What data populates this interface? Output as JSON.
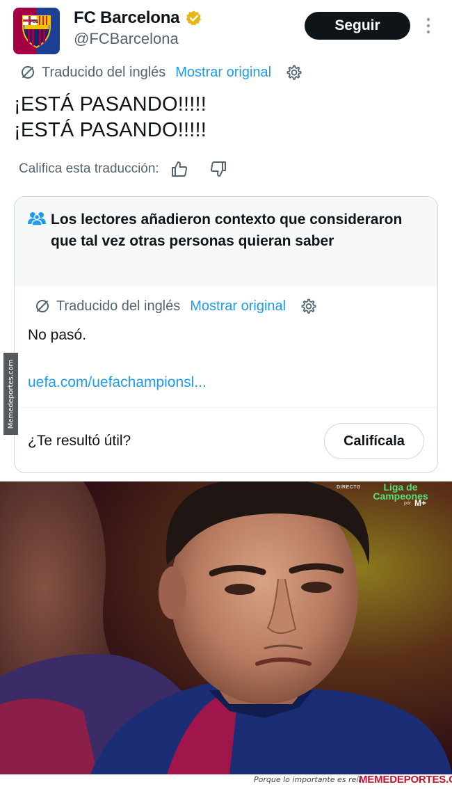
{
  "tweet": {
    "author_name": "FC Barcelona",
    "handle": "@FCBarcelona",
    "follow_label": "Seguir",
    "avatar_text": "FCB",
    "translation": {
      "label": "Traducido del inglés",
      "show_original": "Mostrar original"
    },
    "text_lines": [
      "¡ESTÁ PASANDO!!!!!",
      "¡ESTÁ PASANDO!!!!!"
    ],
    "rate_translation_label": "Califica esta traducción:"
  },
  "community_note": {
    "title": "Los lectores añadieron contexto que consideraron que tal vez otras personas quieran saber",
    "translation": {
      "label": "Traducido del inglés",
      "show_original": "Mostrar original"
    },
    "body": "No pasó.",
    "link": "uefa.com/uefachampionsl...",
    "helpful_question": "¿Te resultó útil?",
    "rate_button": "Califícala"
  },
  "broadcast": {
    "live": "DIRECTO",
    "competition": "Liga de Campeones",
    "por": "por",
    "channel": "M+"
  },
  "watermark": {
    "side": "Memedeportes.com",
    "tagline": "Porque lo importante es reír",
    "brand": "MEMEDEPORTES.COM"
  },
  "colors": {
    "link": "#1d9bf0",
    "verified": "#e8b416",
    "brand": "#c8102e"
  }
}
